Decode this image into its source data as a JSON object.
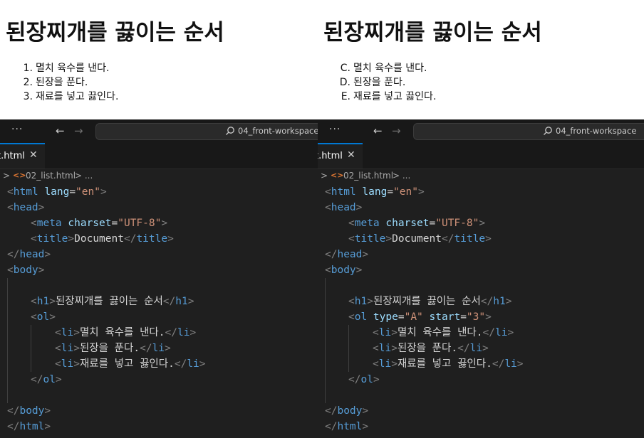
{
  "left": {
    "preview": {
      "heading": "된장찌개를 끓이는 순서",
      "items": [
        {
          "marker": "1.",
          "text": "멸치 육수를 낸다."
        },
        {
          "marker": "2.",
          "text": "된장을 푼다."
        },
        {
          "marker": "3.",
          "text": "재료를 넣고 끓인다."
        }
      ]
    },
    "titlebar": {
      "menu_dots": "···",
      "back": "←",
      "forward": "→",
      "search_label": "04_front-workspace"
    },
    "tab": {
      "name": "t.html",
      "close": "✕"
    },
    "breadcrumb": {
      "chevron": ">",
      "file_icon": "<>",
      "file": "02_list.html",
      "sep": "> ..."
    },
    "code": {
      "l1_open": "<",
      "l1_tag": "html",
      "l1_attr": " lang",
      "l1_eq": "=",
      "l1_val": "\"en\"",
      "l1_close": ">",
      "l2_open": "<",
      "l2_tag": "head",
      "l2_close": ">",
      "l3_open": "<",
      "l3_tag": "meta",
      "l3_attr": " charset",
      "l3_eq": "=",
      "l3_val": "\"UTF-8\"",
      "l3_close": ">",
      "l4_open": "<",
      "l4_tag": "title",
      "l4_mid": ">",
      "l4_text": "Document",
      "l4_end_open": "</",
      "l4_end_tag": "title",
      "l4_close": ">",
      "l5_open": "</",
      "l5_tag": "head",
      "l5_close": ">",
      "l6_open": "<",
      "l6_tag": "body",
      "l6_close": ">",
      "l8_open": "<",
      "l8_tag": "h1",
      "l8_mid": ">",
      "l8_text": "된장찌개를 끓이는 순서",
      "l8_end_open": "</",
      "l8_end_tag": "h1",
      "l8_close": ">",
      "l9_open": "<",
      "l9_tag": "ol",
      "l9_close": ">",
      "l10_open": "<",
      "l10_tag": "li",
      "l10_mid": ">",
      "l10_text": "멸치 육수를 낸다.",
      "l10_end_open": "</",
      "l10_end_tag": "li",
      "l10_close": ">",
      "l11_open": "<",
      "l11_tag": "li",
      "l11_mid": ">",
      "l11_text": "된장을 푼다.",
      "l11_end_open": "</",
      "l11_end_tag": "li",
      "l11_close": ">",
      "l12_open": "<",
      "l12_tag": "li",
      "l12_mid": ">",
      "l12_text": "재료를 넣고 끓인다.",
      "l12_end_open": "</",
      "l12_end_tag": "li",
      "l12_close": ">",
      "l13_open": "</",
      "l13_tag": "ol",
      "l13_close": ">",
      "l15_open": "</",
      "l15_tag": "body",
      "l15_close": ">",
      "l16_open": "</",
      "l16_tag": "html",
      "l16_close": ">"
    }
  },
  "right": {
    "preview": {
      "heading": "된장찌개를 끓이는 순서",
      "items": [
        {
          "marker": "C.",
          "text": "멸치 육수를 낸다."
        },
        {
          "marker": "D.",
          "text": "된장을 푼다."
        },
        {
          "marker": "E.",
          "text": "재료를 넣고 끓인다."
        }
      ]
    },
    "titlebar": {
      "menu_dots": "···",
      "back": "←",
      "forward": "→",
      "search_label": "04_front-workspace"
    },
    "tab": {
      "name": "t.html",
      "close": "✕"
    },
    "breadcrumb": {
      "chevron": ">",
      "file_icon": "<>",
      "file": "02_list.html",
      "sep": "> ..."
    },
    "code": {
      "l1_open": "<",
      "l1_tag": "html",
      "l1_attr": " lang",
      "l1_eq": "=",
      "l1_val": "\"en\"",
      "l1_close": ">",
      "l2_open": "<",
      "l2_tag": "head",
      "l2_close": ">",
      "l3_open": "<",
      "l3_tag": "meta",
      "l3_attr": " charset",
      "l3_eq": "=",
      "l3_val": "\"UTF-8\"",
      "l3_close": ">",
      "l4_open": "<",
      "l4_tag": "title",
      "l4_mid": ">",
      "l4_text": "Document",
      "l4_end_open": "</",
      "l4_end_tag": "title",
      "l4_close": ">",
      "l5_open": "</",
      "l5_tag": "head",
      "l5_close": ">",
      "l6_open": "<",
      "l6_tag": "body",
      "l6_close": ">",
      "l8_open": "<",
      "l8_tag": "h1",
      "l8_mid": ">",
      "l8_text": "된장찌개를 끓이는 순서",
      "l8_end_open": "</",
      "l8_end_tag": "h1",
      "l8_close": ">",
      "l9_open": "<",
      "l9_tag": "ol",
      "l9_attr1": " type",
      "l9_eq1": "=",
      "l9_val1": "\"A\"",
      "l9_attr2": " start",
      "l9_eq2": "=",
      "l9_val2": "\"3\"",
      "l9_close": ">",
      "l10_open": "<",
      "l10_tag": "li",
      "l10_mid": ">",
      "l10_text": "멸치 육수를 낸다.",
      "l10_end_open": "</",
      "l10_end_tag": "li",
      "l10_close": ">",
      "l11_open": "<",
      "l11_tag": "li",
      "l11_mid": ">",
      "l11_text": "된장을 푼다.",
      "l11_end_open": "</",
      "l11_end_tag": "li",
      "l11_close": ">",
      "l12_open": "<",
      "l12_tag": "li",
      "l12_mid": ">",
      "l12_text": "재료를 넣고 끓인다.",
      "l12_end_open": "</",
      "l12_end_tag": "li",
      "l12_close": ">",
      "l13_open": "</",
      "l13_tag": "ol",
      "l13_close": ">",
      "l15_open": "</",
      "l15_tag": "body",
      "l15_close": ">",
      "l16_open": "</",
      "l16_tag": "html",
      "l16_close": ">"
    }
  },
  "colors": {
    "editor_bg": "#1f1f1f",
    "tag": "#569cd6",
    "attribute": "#9cdcfe",
    "string": "#ce9178",
    "punctuation": "#808080",
    "active_tab_accent": "#0078d4"
  }
}
